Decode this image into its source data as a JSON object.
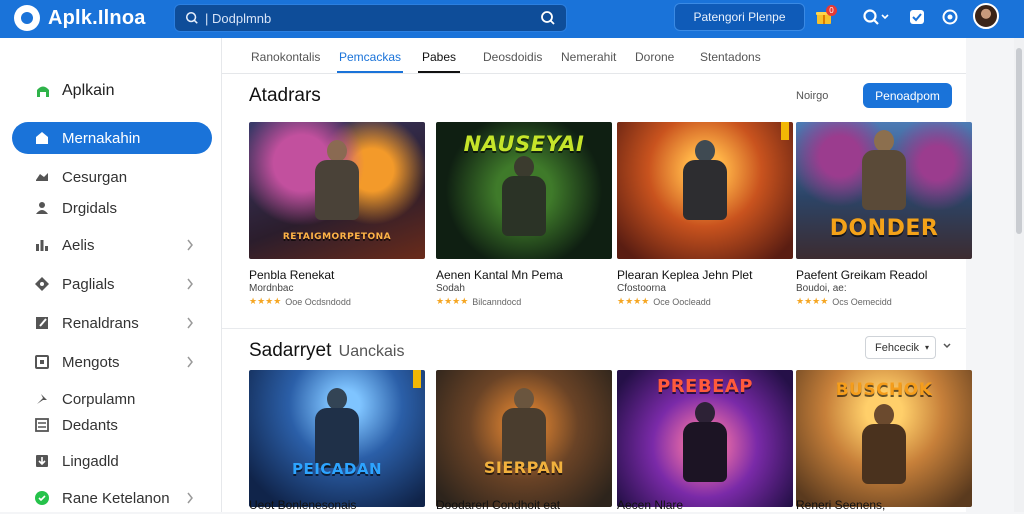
{
  "topbar": {
    "logo_text": "Aplk.Ilnoa",
    "search_placeholder": "| Dodplmnb",
    "premium_label": "Patengori Plenpe",
    "notif_count": "0",
    "icons": [
      "search-icon",
      "gift-icon",
      "notification-icon",
      "chat-icon",
      "settings-icon",
      "avatar"
    ]
  },
  "sidebar": {
    "header": "Aplkain",
    "items": [
      {
        "label": "Mernakahin",
        "icon": "home-icon",
        "chevron": false
      },
      {
        "label": "Cesurgan",
        "icon": "gamepad-icon",
        "chevron": false
      },
      {
        "label": "Drgidals",
        "icon": "user-icon",
        "chevron": false
      },
      {
        "label": "Aelis",
        "icon": "chart-icon",
        "chevron": true
      },
      {
        "label": "Paglials",
        "icon": "puzzle-icon",
        "chevron": true
      },
      {
        "label": "Renaldrans",
        "icon": "edit-icon",
        "chevron": true
      },
      {
        "label": "Mengots",
        "icon": "box-icon",
        "chevron": true
      },
      {
        "label": "Corpulamn",
        "icon": "pin-icon",
        "chevron": false
      },
      {
        "label": "Dedants",
        "icon": "checklist-icon",
        "chevron": false
      },
      {
        "label": "Lingadld",
        "icon": "download-icon",
        "chevron": false
      },
      {
        "label": "Rane Ketelanon",
        "icon": "whatsapp-icon",
        "chevron": true
      }
    ]
  },
  "tabs": [
    "Ranokontalis",
    "Pemcackas",
    "Pabes",
    "Deosdoidis",
    "Nemerahit",
    "Dorone",
    "Stentadons"
  ],
  "section1": {
    "title": "Atadrars",
    "link": "Noirgo",
    "button": "Penoadpom"
  },
  "section2": {
    "title": "Sadarryet",
    "subtitle": "Uanckais",
    "sort_label": "Fehcecik"
  },
  "cards_row1": [
    {
      "title": "Penbla Renekat",
      "sub": "Mordnbac",
      "meta": "Ooe Ocdsndodd",
      "banner": "RETAIGMORPETONA"
    },
    {
      "title": "Aenen Kantal Mn Pema",
      "sub": "Sodah",
      "meta": "Bilcanndocd",
      "banner": "NAUSEYAI"
    },
    {
      "title": "Plearan Keplea Jehn Plet",
      "sub": "Cfostoorna",
      "meta": "Oce Oocleadd",
      "banner": ""
    },
    {
      "title": "Paefent Greikam Readol",
      "sub": "Boudoi, ae:",
      "meta": "Ocs Oemecidd",
      "banner": "DONDER"
    }
  ],
  "cards_row2": [
    {
      "title": "Ueot Bonlenesonais",
      "banner": "PEICADAN"
    },
    {
      "title": "Doodarerl Condhoit eat",
      "banner": "SIERPAN"
    },
    {
      "title": "Aecen Nlare",
      "banner": "PREBEAP"
    },
    {
      "title": "Reneri Seenens,",
      "banner": "BUSCHOK"
    }
  ],
  "colors": {
    "brand": "#1a73d9",
    "star": "#f5a623"
  }
}
